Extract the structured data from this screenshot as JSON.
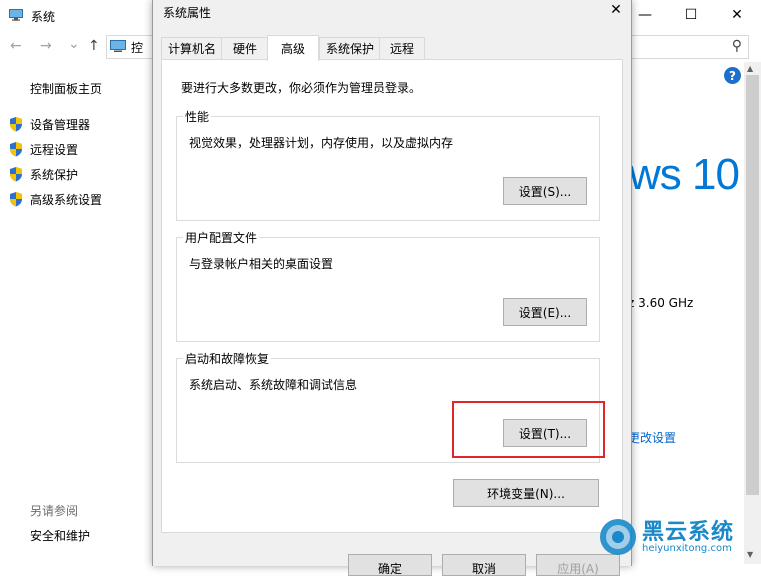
{
  "background_window": {
    "title": "系统",
    "controls": {
      "minimize": "—",
      "maximize": "☐",
      "close": "✕"
    },
    "nav": {
      "back": "←",
      "forward": "→",
      "down": "⌄",
      "up": "↑",
      "addr_fragment": "控",
      "search_icon": "⚲"
    },
    "sidebar": {
      "home": "控制面板主页",
      "items": [
        {
          "label": "设备管理器",
          "icon": "shield-icon"
        },
        {
          "label": "远程设置",
          "icon": "shield-icon"
        },
        {
          "label": "系统保护",
          "icon": "shield-icon"
        },
        {
          "label": "高级系统设置",
          "icon": "shield-icon"
        }
      ],
      "see_also": "另请参阅",
      "security": "安全和维护"
    },
    "main": {
      "win10_fragment": "ws 10",
      "cpu_fragment": "z   3.60 GHz",
      "change_settings_fragment": "更改设置",
      "help": "?"
    }
  },
  "dialog": {
    "title": "系统属性",
    "close": "✕",
    "tabs": [
      {
        "label": "计算机名",
        "active": false
      },
      {
        "label": "硬件",
        "active": false
      },
      {
        "label": "高级",
        "active": true
      },
      {
        "label": "系统保护",
        "active": false
      },
      {
        "label": "远程",
        "active": false
      }
    ],
    "admin_note": "要进行大多数更改，你必须作为管理员登录。",
    "groups": {
      "performance": {
        "legend": "性能",
        "desc": "视觉效果，处理器计划，内存使用，以及虚拟内存",
        "button": "设置(S)..."
      },
      "user_profiles": {
        "legend": "用户配置文件",
        "desc": "与登录帐户相关的桌面设置",
        "button": "设置(E)..."
      },
      "startup_recovery": {
        "legend": "启动和故障恢复",
        "desc": "系统启动、系统故障和调试信息",
        "button": "设置(T)..."
      }
    },
    "env_button": "环境变量(N)...",
    "bottom_buttons": [
      "确定",
      "取消",
      "应用(A)"
    ]
  },
  "watermark": {
    "title": "黑云系统",
    "url": "heiyunxitong.com"
  },
  "colors": {
    "accent": "#0078d7",
    "highlight": "#e0262b",
    "watermark": "#1a88c9"
  }
}
